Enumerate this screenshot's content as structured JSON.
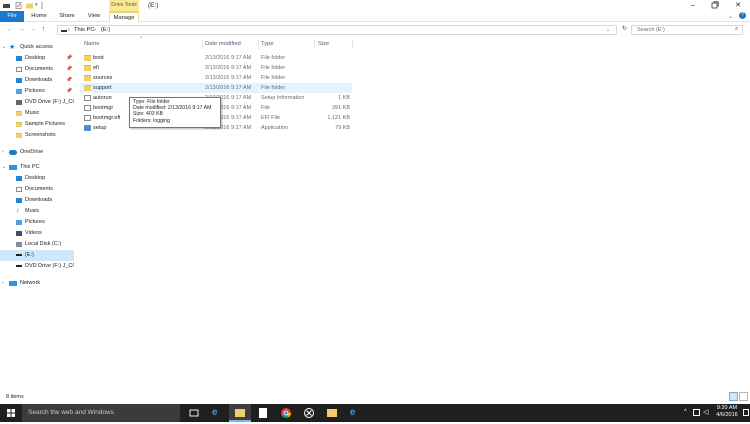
{
  "window": {
    "title": "(E:)"
  },
  "ribbon": {
    "tabs": [
      "File",
      "Home",
      "Share",
      "View"
    ],
    "contextual_group": "Drive Tools",
    "contextual_tab": "Manage"
  },
  "address": {
    "root": "This PC",
    "sep": "›",
    "drive": "(E:)"
  },
  "search": {
    "placeholder": "Search (E:)"
  },
  "sidebar": {
    "quick_access": "Quick access",
    "qa_items": [
      "Desktop",
      "Documents",
      "Downloads",
      "Pictures",
      "DVD Drive (F:) J_CCS",
      "Music",
      "Sample Pictures",
      "Screenshots"
    ],
    "onedrive": "OneDrive",
    "this_pc": "This PC",
    "pc_items": [
      "Desktop",
      "Documents",
      "Downloads",
      "Music",
      "Pictures",
      "Videos",
      "Local Disk (C:)",
      "(E:)",
      "DVD Drive (F:) J_CCS"
    ],
    "network": "Network"
  },
  "columns": {
    "name": "Name",
    "date": "Date modified",
    "type": "Type",
    "size": "Size"
  },
  "files": [
    {
      "name": "boot",
      "date": "2/13/2016 9:17 AM",
      "type": "File folder",
      "size": "",
      "icon": "folder-icon"
    },
    {
      "name": "efi",
      "date": "2/13/2016 9:17 AM",
      "type": "File folder",
      "size": "",
      "icon": "folder-icon"
    },
    {
      "name": "sources",
      "date": "2/13/2016 9:17 AM",
      "type": "File folder",
      "size": "",
      "icon": "folder-icon"
    },
    {
      "name": "support",
      "date": "2/13/2016 9:17 AM",
      "type": "File folder",
      "size": "",
      "icon": "folder-icon"
    },
    {
      "name": "autorun",
      "date": "2/13/2016 9:17 AM",
      "type": "Setup Information",
      "size": "1 KB",
      "icon": "setup-info-icon"
    },
    {
      "name": "bootmgr",
      "date": "2/13/2016 9:17 AM",
      "type": "File",
      "size": "391 KB",
      "icon": "file-icon"
    },
    {
      "name": "bootmgr.efi",
      "date": "2/13/2016 9:17 AM",
      "type": "EFI File",
      "size": "1,121 KB",
      "icon": "file-icon"
    },
    {
      "name": "setup",
      "date": "2/13/2016 9:17 AM",
      "type": "Application",
      "size": "79 KB",
      "icon": "setup-app-icon"
    }
  ],
  "tooltip": {
    "line1": "Type: File folder",
    "line2": "Date modified: 2/13/2016 9:17 AM",
    "line3": "Size: 403 KB",
    "line4": "Folders: logging"
  },
  "status": {
    "items": "8 items"
  },
  "taskbar": {
    "search_placeholder": "Search the web and Windows",
    "time": "9:20 AM",
    "date": "4/6/2016"
  },
  "colors": {
    "accent": "#1979ca",
    "selection": "#cce8ff",
    "hover": "#e5f3ff",
    "folder": "#f3cf67",
    "taskbar": "#1f1f1f"
  }
}
